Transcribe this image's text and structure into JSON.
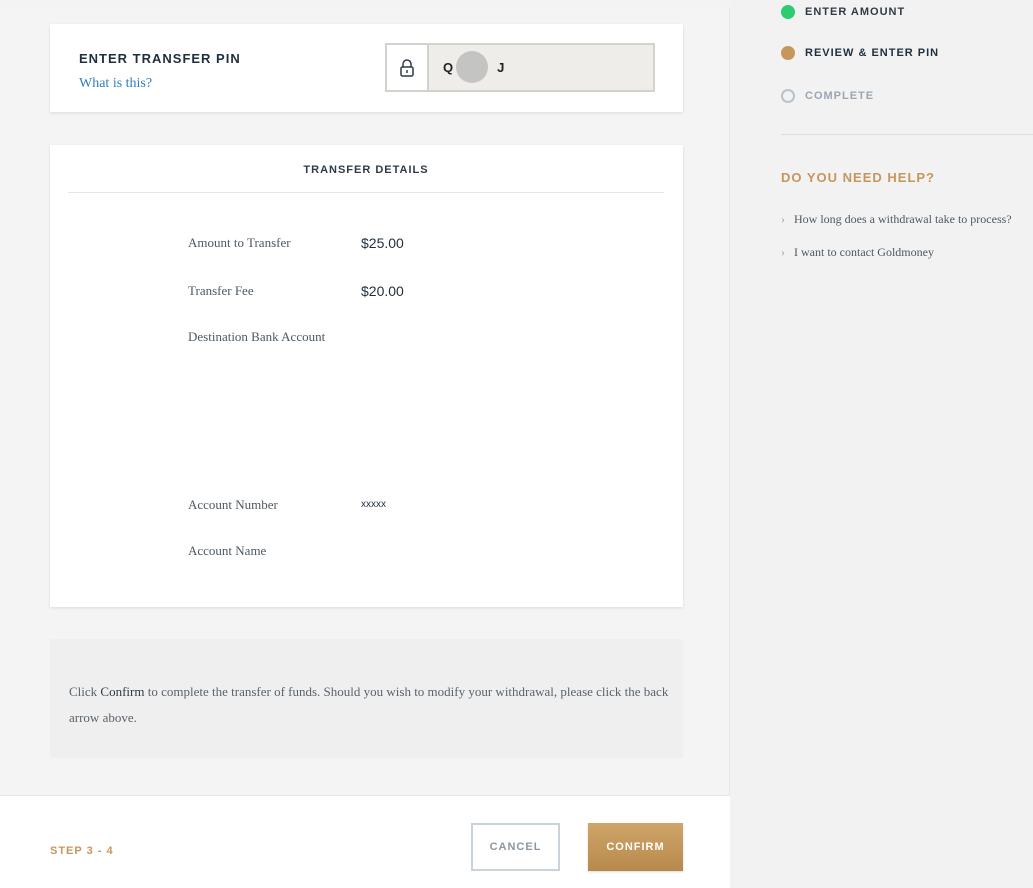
{
  "pin": {
    "title": "ENTER TRANSFER PIN",
    "help_link": "What is this?",
    "value": "Q",
    "value_end": "J"
  },
  "details": {
    "header": "TRANSFER DETAILS",
    "rows": [
      {
        "label": "Amount to Transfer",
        "value": "$25.00"
      },
      {
        "label": "Transfer Fee",
        "value": "$20.00"
      },
      {
        "label": "Destination Bank Account",
        "value": ""
      },
      {
        "label": "Account Number",
        "value": "xxxxx"
      },
      {
        "label": "Account Name",
        "value": ""
      }
    ]
  },
  "info": {
    "prefix": "Click ",
    "emphasis": "Confirm",
    "suffix": " to complete the transfer of funds. Should you wish to modify your withdrawal, please click the back arrow above."
  },
  "footer": {
    "step": "STEP 3 - 4",
    "cancel": "CANCEL",
    "confirm": "CONFIRM"
  },
  "sidebar": {
    "steps": [
      {
        "label": "ENTER AMOUNT",
        "status": "done",
        "color": "#2ecc71"
      },
      {
        "label": "REVIEW & ENTER PIN",
        "status": "current",
        "color": "#c6975c"
      },
      {
        "label": "COMPLETE",
        "status": "pending",
        "color": "#b7c2cc"
      }
    ],
    "help_title": "DO YOU NEED HELP?",
    "help_links": [
      "How long does a withdrawal take to process?",
      "I want to contact Goldmoney"
    ]
  }
}
